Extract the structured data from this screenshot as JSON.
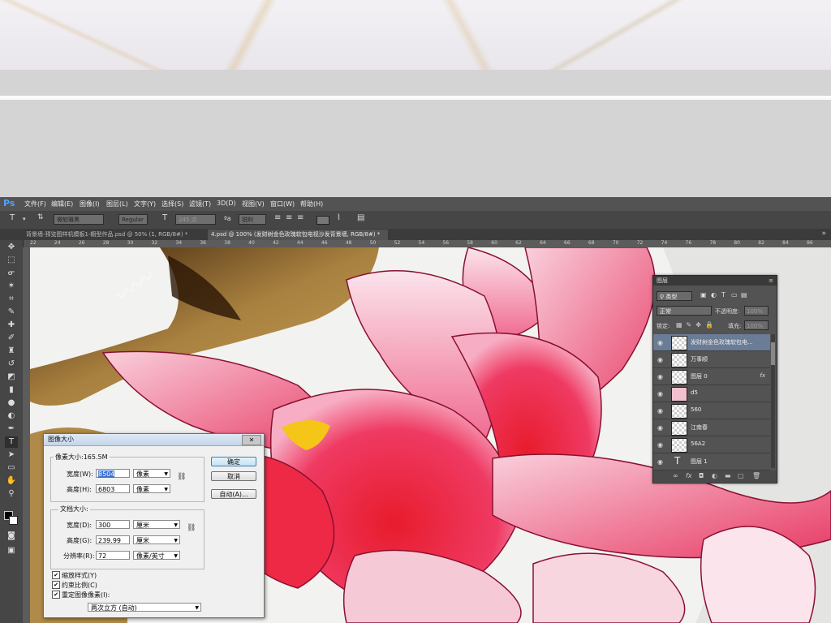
{
  "photoshop": {
    "logo": "Ps",
    "menu": [
      "文件(F)",
      "编辑(E)",
      "图像(I)",
      "图层(L)",
      "文字(Y)",
      "选择(S)",
      "滤镜(T)",
      "3D(D)",
      "视图(V)",
      "窗口(W)",
      "帮助(H)"
    ],
    "options": {
      "tool_icon": "T",
      "font_family": "微软雅黑",
      "font_style": "Regular",
      "font_size": "245 点",
      "antialias": "锐利"
    },
    "tabs": [
      "背景墙-预览图样机模板1-橱型作品.psd @ 50% (1, RGB/8#) *",
      "4.psd @ 100% (发财树金色玫瑰软包电视沙发背景墙, RGB/8#) *"
    ],
    "ruler_marks": [
      "22",
      "24",
      "26",
      "28",
      "30",
      "32",
      "34",
      "36",
      "38",
      "40",
      "42",
      "44",
      "46",
      "48",
      "50",
      "52",
      "54",
      "56",
      "58",
      "60",
      "62",
      "64",
      "66",
      "68",
      "70",
      "72",
      "74",
      "76",
      "78",
      "80",
      "82",
      "84",
      "86"
    ]
  },
  "layers_panel": {
    "title": "图层",
    "filter": "类型",
    "blend_mode": "正常",
    "opacity_label": "不透明度:",
    "opacity_value": "100%",
    "lock_label": "锁定:",
    "fill_label": "填充:",
    "fill_value": "100%",
    "layers": [
      {
        "name": "发财树金色玫瑰软包电...",
        "selected": true
      },
      {
        "name": "万事顺"
      },
      {
        "name": "图层 0",
        "fx": "fx"
      },
      {
        "name": "d5"
      },
      {
        "name": "560"
      },
      {
        "name": "江南春"
      },
      {
        "name": "56A2"
      },
      {
        "name": "图层 1",
        "type_icon": "T"
      }
    ]
  },
  "dialog": {
    "title": "图像大小",
    "pixel_dimensions": "像素大小:165.5M",
    "width_label": "宽度(W):",
    "width_value": "8504",
    "width_unit": "像素",
    "height_label": "高度(H):",
    "height_value": "6803",
    "height_unit": "像素",
    "doc_size_label": "文档大小:",
    "doc_width_label": "宽度(D):",
    "doc_width_value": "300",
    "doc_width_unit": "厘米",
    "doc_height_label": "高度(G):",
    "doc_height_value": "239.99",
    "doc_height_unit": "厘米",
    "resolution_label": "分辨率(R):",
    "resolution_value": "72",
    "resolution_unit": "像素/英寸",
    "ok": "确定",
    "cancel": "取消",
    "auto": "自动(A)...",
    "scale_styles": "缩放样式(Y)",
    "constrain": "约束比例(C)",
    "resample": "重定图像像素(I):",
    "resample_method": "两次立方 (自动)"
  },
  "colors": {
    "ps_bg": "#535353",
    "petal": "#e8305a",
    "petal_light": "#f7b3c8"
  }
}
